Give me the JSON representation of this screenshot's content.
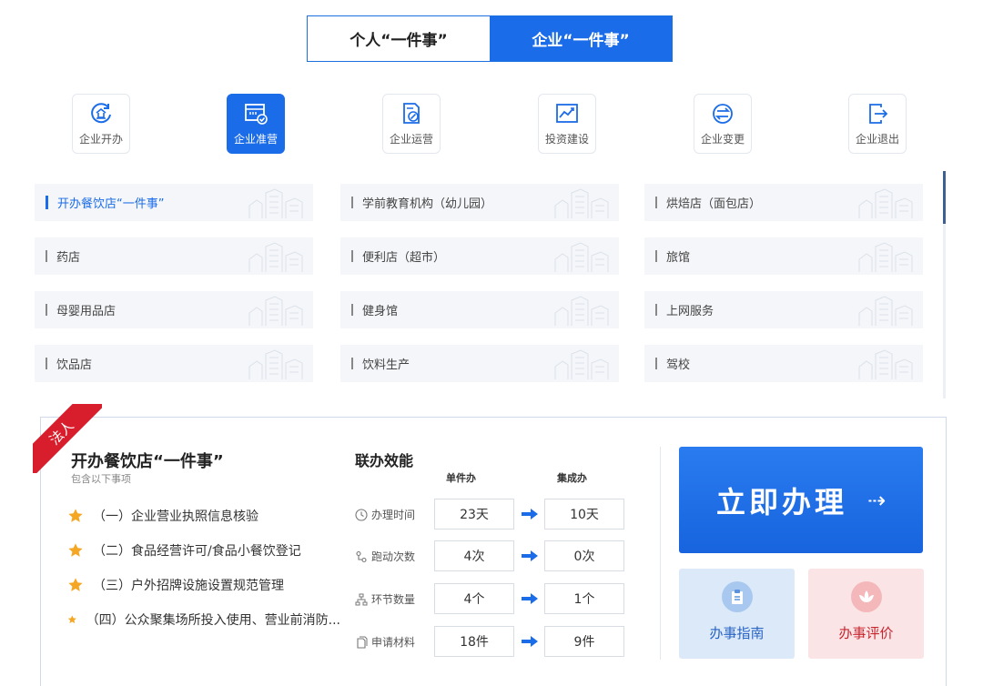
{
  "top_tabs": [
    {
      "label": "个人“一件事”",
      "active": false
    },
    {
      "label": "企业“一件事”",
      "active": true
    }
  ],
  "categories": [
    {
      "label": "企业开办",
      "icon": "company-seal-icon",
      "active": false
    },
    {
      "label": "企业准营",
      "icon": "license-check-icon",
      "active": true
    },
    {
      "label": "企业运营",
      "icon": "document-edit-icon",
      "active": false
    },
    {
      "label": "投资建设",
      "icon": "chart-growth-icon",
      "active": false
    },
    {
      "label": "企业变更",
      "icon": "exchange-icon",
      "active": false
    },
    {
      "label": "企业退出",
      "icon": "exit-icon",
      "active": false
    }
  ],
  "services": [
    [
      "开办餐饮店“一件事”",
      "学前教育机构（幼儿园）",
      "烘焙店（面包店）"
    ],
    [
      "药店",
      "便利店（超市）",
      "旅馆"
    ],
    [
      "母婴用品店",
      "健身馆",
      "上网服务"
    ],
    [
      "饮品店",
      "饮料生产",
      "驾校"
    ]
  ],
  "active_service": "开办餐饮店“一件事”",
  "detail": {
    "ribbon": "法人",
    "title": "开办餐饮店“一件事”",
    "subtitle": "包含以下事项",
    "items": [
      "（一）企业营业执照信息核验",
      "（二）食品经营许可/食品小餐饮登记",
      "（三）户外招牌设施设置规范管理",
      "（四）公众聚集场所投入使用、营业前消防..."
    ]
  },
  "efficiency": {
    "title": "联办效能",
    "col_single": "单件办",
    "col_joint": "集成办",
    "rows": [
      {
        "label": "办理时间",
        "icon": "clock-icon",
        "single": "23天",
        "joint": "10天"
      },
      {
        "label": "跑动次数",
        "icon": "route-icon",
        "single": "4次",
        "joint": "0次"
      },
      {
        "label": "环节数量",
        "icon": "flow-steps-icon",
        "single": "4个",
        "joint": "1个"
      },
      {
        "label": "申请材料",
        "icon": "files-icon",
        "single": "18件",
        "joint": "9件"
      }
    ]
  },
  "actions": {
    "apply_label": "立即办理",
    "apply_arrow": "⇢",
    "guide_label": "办事指南",
    "rate_label": "办事评价"
  },
  "colors": {
    "primary": "#1b6ce8",
    "ribbon_red": "#d81e2c",
    "star": "#f5a623"
  }
}
